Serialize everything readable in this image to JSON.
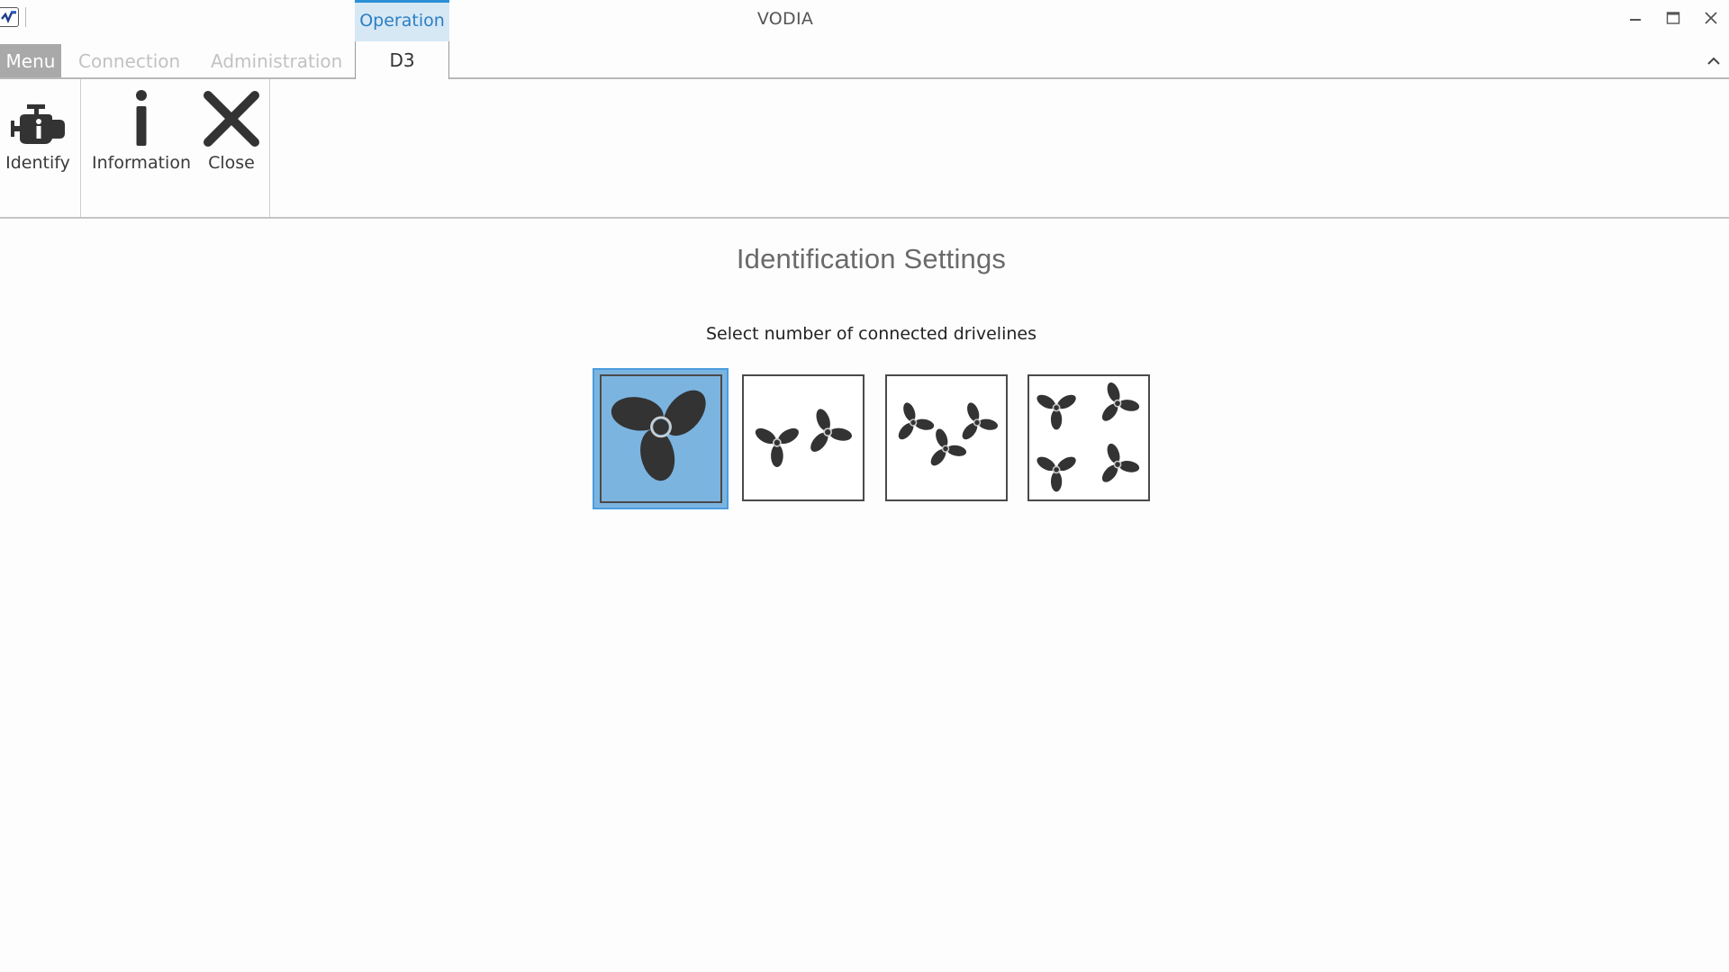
{
  "window": {
    "title": "VODIA",
    "app_icon": "vodia-logo-icon",
    "controls": {
      "minimize": "minimize-icon",
      "maximize": "maximize-icon",
      "close": "close-icon"
    }
  },
  "context_tab": {
    "label": "Operation",
    "color": "#2a7fc2",
    "background": "#d7e8f5"
  },
  "tabs": [
    {
      "label": "Menu",
      "state": "menu"
    },
    {
      "label": "Connection",
      "state": "disabled"
    },
    {
      "label": "Administration",
      "state": "disabled"
    },
    {
      "label": "D3",
      "state": "active"
    }
  ],
  "ribbon": {
    "buttons": [
      {
        "label": "Identify",
        "icon": "engine-info-icon"
      },
      {
        "label": "Information",
        "icon": "info-icon"
      },
      {
        "label": "Close",
        "icon": "close-x-icon"
      }
    ]
  },
  "content": {
    "heading": "Identification Settings",
    "subheading": "Select number of connected drivelines",
    "driveline_options": [
      {
        "count": 1,
        "icon": "single-propeller-icon",
        "selected": true
      },
      {
        "count": 2,
        "icon": "twin-propeller-icon",
        "selected": false
      },
      {
        "count": 3,
        "icon": "triple-propeller-icon",
        "selected": false
      },
      {
        "count": 4,
        "icon": "quad-propeller-icon",
        "selected": false
      }
    ],
    "selected_color": "#7cb4e0"
  }
}
